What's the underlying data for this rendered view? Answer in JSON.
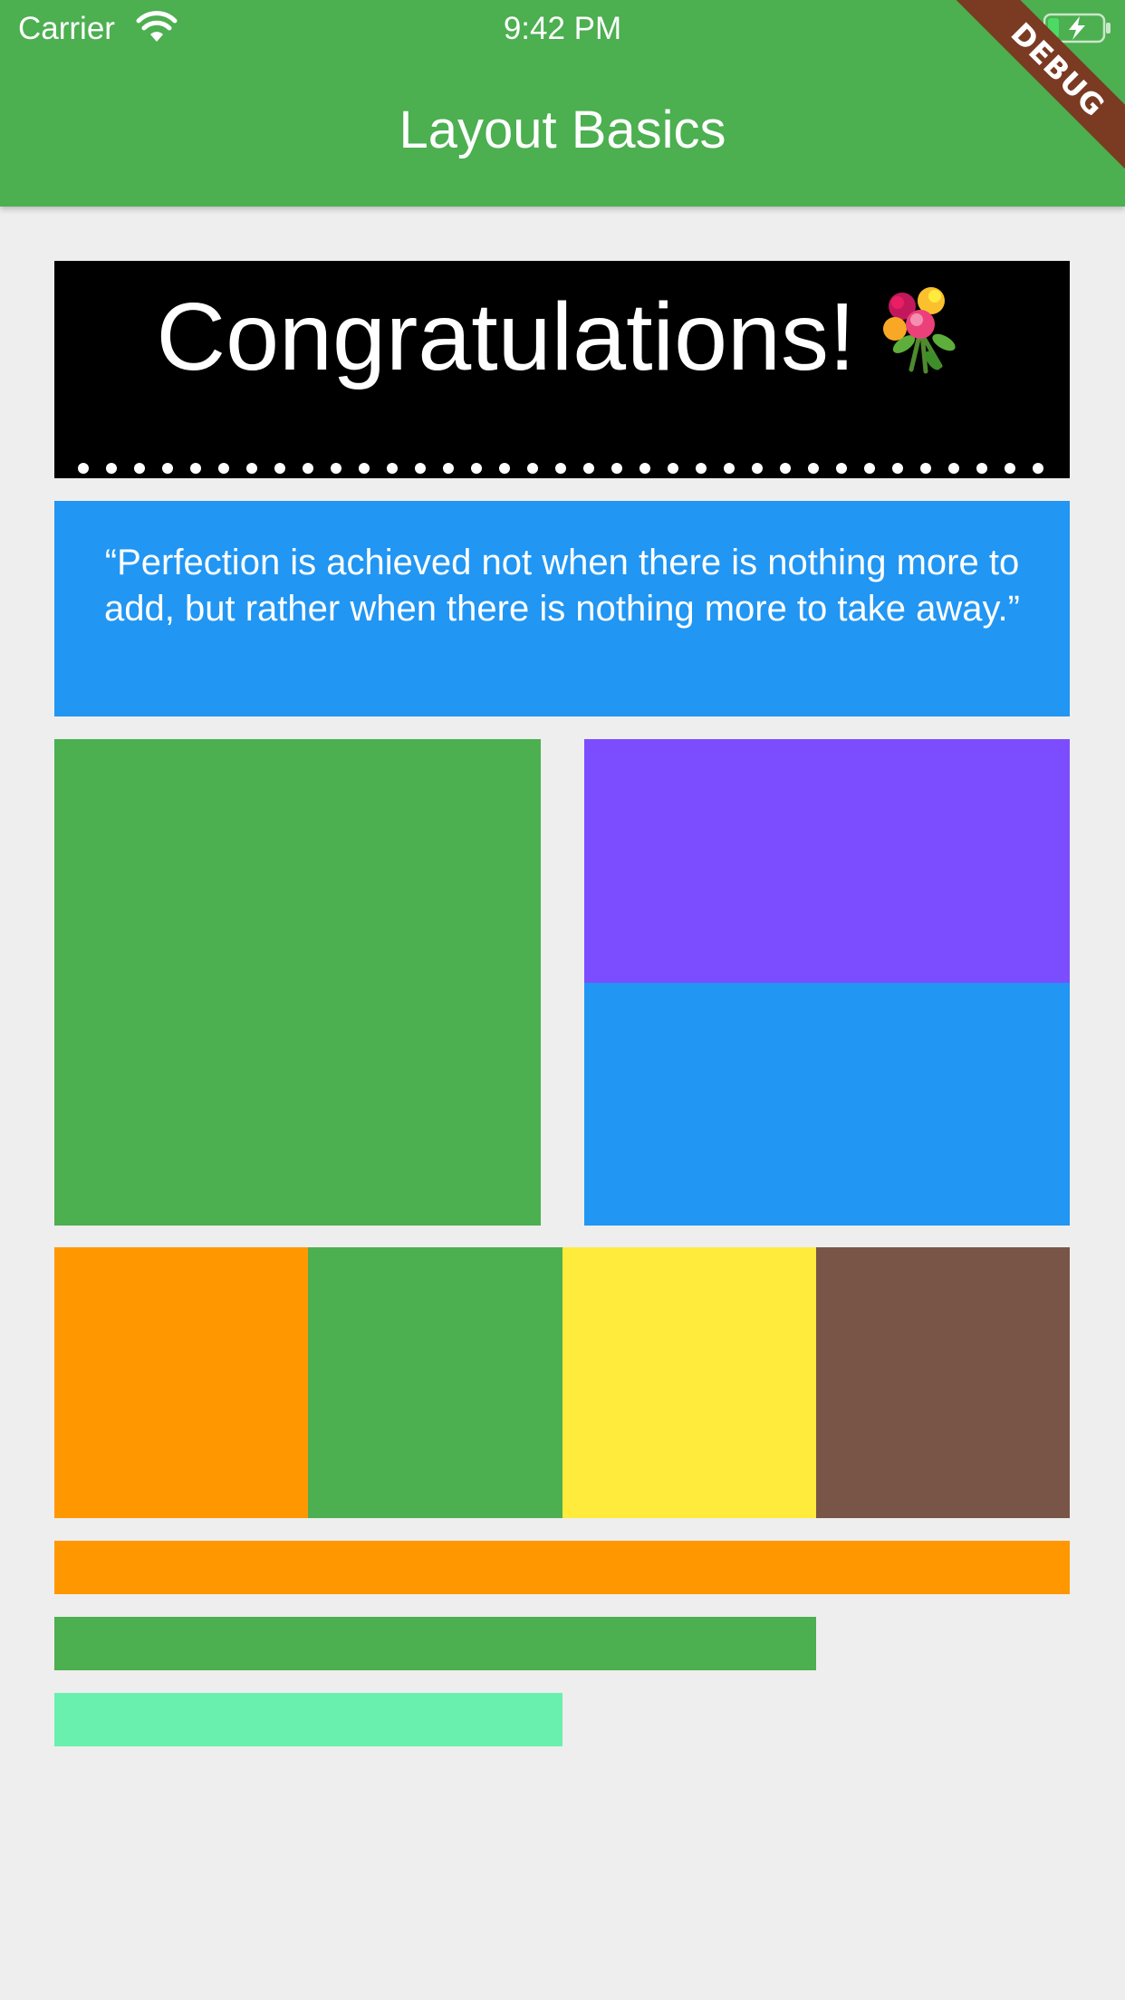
{
  "status_bar": {
    "carrier": "Carrier",
    "time": "9:42 PM",
    "icons": [
      "wifi-icon",
      "battery-charging-icon"
    ]
  },
  "app_bar": {
    "title": "Layout Basics",
    "color": "#4CAF50"
  },
  "debug_banner": {
    "label": "DEBUG"
  },
  "banner": {
    "text": "Congratulations!",
    "icon": "bouquet-icon",
    "background": "#000000"
  },
  "quote": {
    "text": "“Perfection is achieved not when there is nothing more to add, but rather when there is nothing more to take away.”",
    "background": "#2196F3"
  },
  "grid_colors": {
    "left": "#4CAF50",
    "right_top": "#7C4DFF",
    "right_bottom": "#2196F3"
  },
  "row_colors": [
    "#FF9800",
    "#4CAF50",
    "#FFEB3B",
    "#795548"
  ],
  "bars": [
    {
      "color": "#FF9800",
      "fraction": 1.0
    },
    {
      "color": "#4CAF50",
      "fraction": 0.75
    },
    {
      "color": "#69F0AE",
      "fraction": 0.5
    }
  ]
}
